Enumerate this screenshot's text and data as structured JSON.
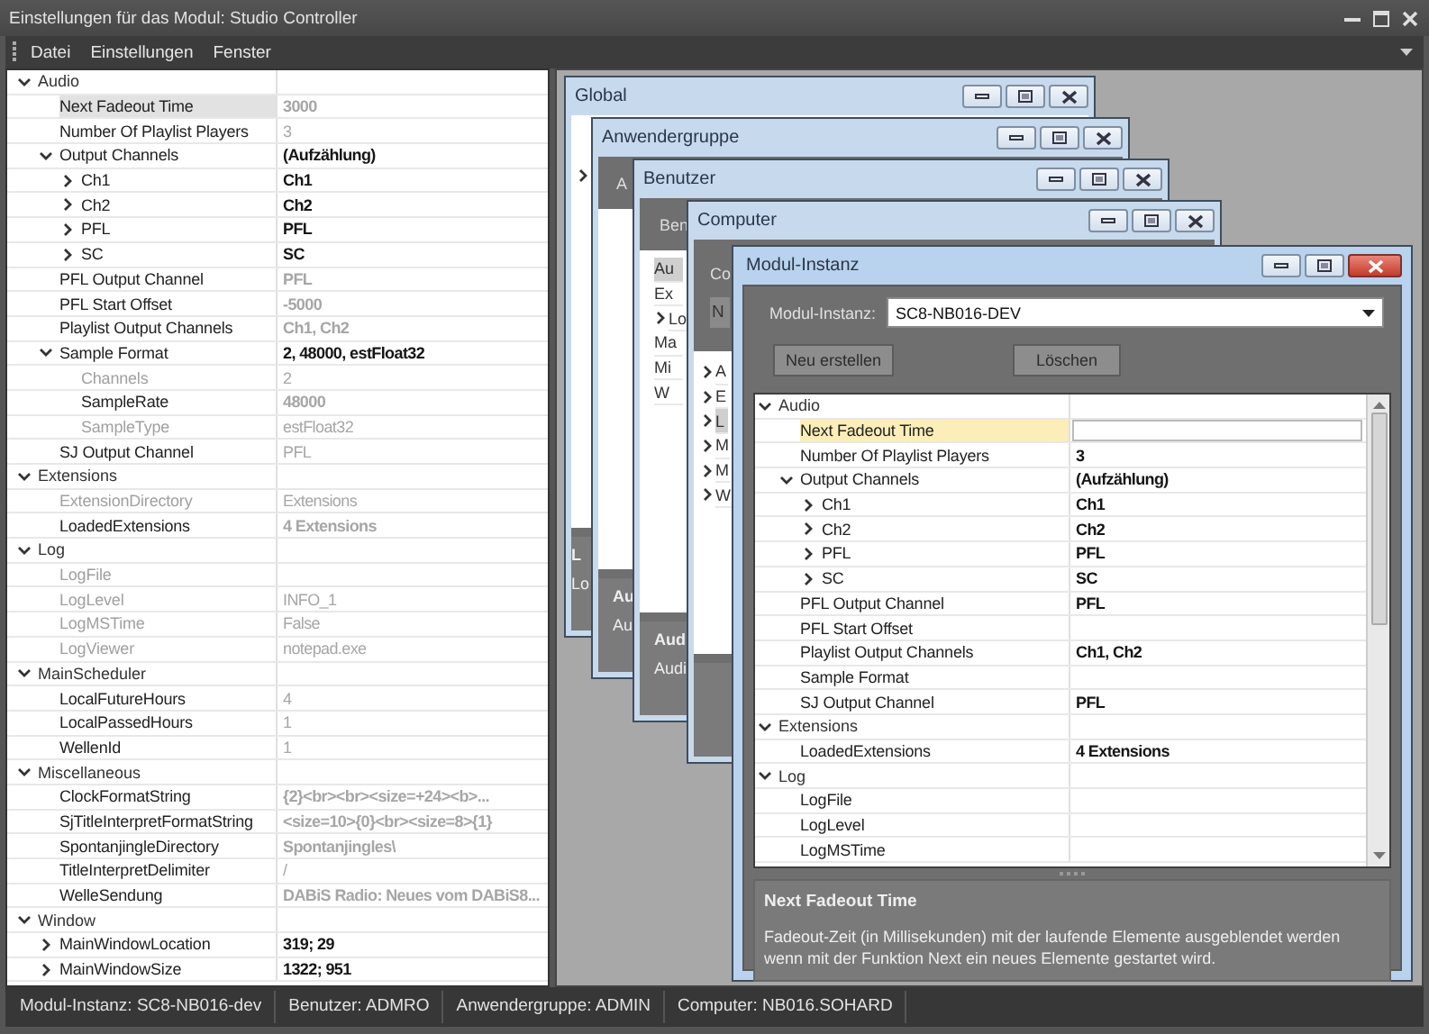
{
  "window": {
    "title": "Einstellungen für das Modul: Studio Controller"
  },
  "menu": [
    "Datei",
    "Einstellungen",
    "Fenster"
  ],
  "settings_grid": [
    {
      "kind": "category",
      "name": "Audio",
      "expanded": true,
      "children": [
        {
          "kind": "set",
          "name": "Next Fadeout Time",
          "value": "3000",
          "selected": true
        },
        {
          "kind": "plain",
          "name": "Number Of Playlist Players",
          "value": "3",
          "selected": false
        },
        {
          "kind": "changed",
          "name": "Output Channels",
          "value": "(Aufzählung)",
          "selected": false,
          "expanded": true,
          "children": [
            {
              "kind": "changed",
              "name": "Ch1",
              "value": "Ch1",
              "selected": false,
              "expanded": false
            },
            {
              "kind": "changed",
              "name": "Ch2",
              "value": "Ch2",
              "selected": false,
              "expanded": false
            },
            {
              "kind": "changed",
              "name": "PFL",
              "value": "PFL",
              "selected": false,
              "expanded": false
            },
            {
              "kind": "changed",
              "name": "SC",
              "value": "SC",
              "selected": false,
              "expanded": false
            }
          ]
        },
        {
          "kind": "set",
          "name": "PFL Output Channel",
          "value": "PFL",
          "selected": false
        },
        {
          "kind": "set",
          "name": "PFL Start Offset",
          "value": "-5000",
          "selected": false
        },
        {
          "kind": "set",
          "name": "Playlist Output Channels",
          "value": "Ch1, Ch2",
          "selected": false
        },
        {
          "kind": "changed",
          "name": "Sample Format",
          "value": "2, 48000, estFloat32",
          "selected": false,
          "expanded": true,
          "children": [
            {
              "kind": "readonly",
              "name": "Channels",
              "value": "2",
              "selected": false
            },
            {
              "kind": "set",
              "name": "SampleRate",
              "value": "48000",
              "selected": false
            },
            {
              "kind": "readonly",
              "name": "SampleType",
              "value": "estFloat32",
              "selected": false
            }
          ]
        },
        {
          "kind": "plain",
          "name": "SJ Output Channel",
          "value": "PFL",
          "selected": false
        }
      ]
    },
    {
      "kind": "category",
      "name": "Extensions",
      "expanded": true,
      "children": [
        {
          "kind": "readonly",
          "name": "ExtensionDirectory",
          "value": "Extensions",
          "selected": false
        },
        {
          "kind": "set",
          "name": "LoadedExtensions",
          "value": "4 Extensions",
          "selected": false
        }
      ]
    },
    {
      "kind": "category",
      "name": "Log",
      "expanded": true,
      "children": [
        {
          "kind": "readonly",
          "name": "LogFile",
          "selected": false
        },
        {
          "kind": "readonly",
          "name": "LogLevel",
          "value": "INFO_1",
          "selected": false
        },
        {
          "kind": "readonly",
          "name": "LogMSTime",
          "value": "False",
          "selected": false
        },
        {
          "kind": "readonly",
          "name": "LogViewer",
          "value": "notepad.exe",
          "selected": false
        }
      ]
    },
    {
      "kind": "category",
      "name": "MainScheduler",
      "expanded": true,
      "children": [
        {
          "kind": "plain",
          "name": "LocalFutureHours",
          "value": "4",
          "selected": false
        },
        {
          "kind": "plain",
          "name": "LocalPassedHours",
          "value": "1",
          "selected": false
        },
        {
          "kind": "plain",
          "name": "WellenId",
          "value": "1",
          "selected": false
        }
      ]
    },
    {
      "kind": "category",
      "name": "Miscellaneous",
      "expanded": true,
      "children": [
        {
          "kind": "set",
          "name": "ClockFormatString",
          "value": "{2}<br><br><size=+24><b>...",
          "selected": false
        },
        {
          "kind": "set",
          "name": "SjTitleInterpretFormatString",
          "value": "<size=10>{0}<br><size=8>{1}",
          "selected": false
        },
        {
          "kind": "set",
          "name": "SpontanjingleDirectory",
          "value": "Spontanjingles\\",
          "selected": false
        },
        {
          "kind": "plain",
          "name": "TitleInterpretDelimiter",
          "value": "/",
          "selected": false
        },
        {
          "kind": "set",
          "name": "WelleSendung",
          "value": "DABiS Radio: Neues vom DABiS8...",
          "selected": false
        }
      ]
    },
    {
      "kind": "category",
      "name": "Window",
      "expanded": true,
      "children": [
        {
          "kind": "changed",
          "name": "MainWindowLocation",
          "value": "319; 29",
          "selected": false,
          "expanded": false
        },
        {
          "kind": "changed",
          "name": "MainWindowSize",
          "value": "1322; 951",
          "selected": false,
          "expanded": false
        }
      ]
    }
  ],
  "background_windows": [
    {
      "title": "Global",
      "active": false,
      "rows": [
        {
          "expanded": false
        }
      ],
      "footer_title": "L",
      "footer_text": "Lo"
    },
    {
      "title": "Anwendergruppe",
      "active": false,
      "header": "A",
      "footer_title": "Au",
      "footer_text": "Au"
    },
    {
      "title": "Benutzer",
      "active": false,
      "header": "Ben",
      "rows": [
        {
          "label": "Au",
          "selected": true
        },
        {
          "label": "Ex",
          "selected": false
        },
        {
          "label": "Lo",
          "selected": false,
          "expanded": false
        },
        {
          "label": "Ma",
          "selected": false
        },
        {
          "label": "Mi",
          "selected": false
        },
        {
          "label": "W",
          "selected": false
        }
      ],
      "footer_title": "Aud",
      "footer_text": "Audi"
    },
    {
      "title": "Computer",
      "active": false,
      "header": "Co",
      "button": "N",
      "rows": [
        {
          "label": "A",
          "selected": false,
          "expanded": false
        },
        {
          "label": "E",
          "selected": false,
          "expanded": false
        },
        {
          "label": "L",
          "selected": true,
          "expanded": false
        },
        {
          "label": "M",
          "selected": false,
          "expanded": false
        },
        {
          "label": "M",
          "selected": false,
          "expanded": false
        },
        {
          "label": "W",
          "selected": false,
          "expanded": false
        }
      ]
    }
  ],
  "module_window": {
    "title": "Modul-Instanz",
    "active": true,
    "instance_label": "Modul-Instanz:",
    "instance_value": "SC8-NB016-DEV",
    "buttons": [
      "Neu erstellen",
      "Löschen"
    ],
    "grid": [
      {
        "kind": "category",
        "name": "Audio",
        "expanded": true,
        "children": [
          {
            "kind": "plain",
            "name": "Next Fadeout Time",
            "selected": true
          },
          {
            "kind": "changed",
            "name": "Number Of Playlist Players",
            "value": "3",
            "selected": false
          },
          {
            "kind": "changed",
            "name": "Output Channels",
            "value": "(Aufzählung)",
            "selected": false,
            "expanded": true,
            "children": [
              {
                "kind": "changed",
                "name": "Ch1",
                "value": "Ch1",
                "selected": false,
                "expanded": false
              },
              {
                "kind": "changed",
                "name": "Ch2",
                "value": "Ch2",
                "selected": false,
                "expanded": false
              },
              {
                "kind": "changed",
                "name": "PFL",
                "value": "PFL",
                "selected": false,
                "expanded": false
              },
              {
                "kind": "changed",
                "name": "SC",
                "value": "SC",
                "selected": false,
                "expanded": false
              }
            ]
          },
          {
            "kind": "changed",
            "name": "PFL Output Channel",
            "value": "PFL",
            "selected": false
          },
          {
            "kind": "plain",
            "name": "PFL Start Offset",
            "selected": false
          },
          {
            "kind": "changed",
            "name": "Playlist Output Channels",
            "value": "Ch1, Ch2",
            "selected": false
          },
          {
            "kind": "plain",
            "name": "Sample Format",
            "selected": false
          },
          {
            "kind": "changed",
            "name": "SJ Output Channel",
            "value": "PFL",
            "selected": false
          }
        ]
      },
      {
        "kind": "category",
        "name": "Extensions",
        "expanded": true,
        "children": [
          {
            "kind": "changed",
            "name": "LoadedExtensions",
            "value": "4 Extensions",
            "selected": false
          }
        ]
      },
      {
        "kind": "category",
        "name": "Log",
        "expanded": true,
        "children": [
          {
            "kind": "plain",
            "name": "LogFile",
            "selected": false
          },
          {
            "kind": "plain",
            "name": "LogLevel",
            "selected": false
          },
          {
            "kind": "plain",
            "name": "LogMSTime",
            "selected": false
          }
        ]
      }
    ],
    "description_title": "Next Fadeout Time",
    "description": "Fadeout-Zeit (in Millisekunden) mit der laufende Elemente ausgeblendet werden wenn mit der Funktion Next ein neues Elemente gestartet wird."
  },
  "status_bar": [
    "Modul-Instanz: SC8-NB016-dev",
    "Benutzer: ADMRO",
    "Anwendergruppe: ADMIN",
    "Computer: NB016.SOHARD"
  ]
}
